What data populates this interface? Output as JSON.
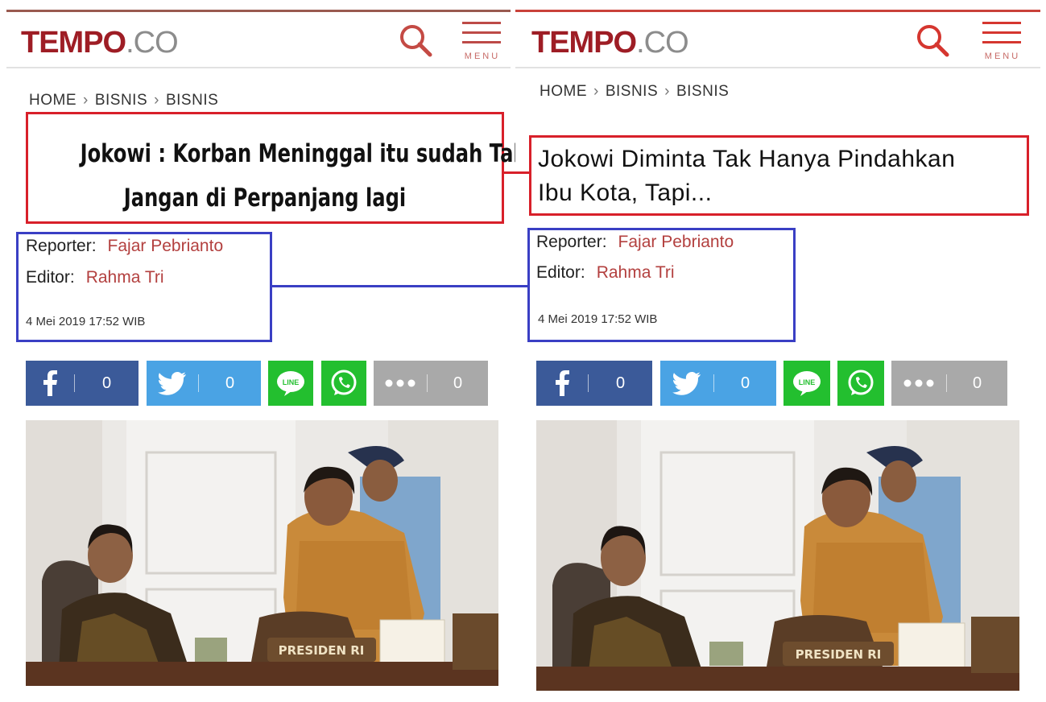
{
  "left": {
    "logo_bold": "TEMPO",
    "logo_light": ".CO",
    "menu_label": "MENU",
    "breadcrumb": [
      "HOME",
      "BISNIS",
      "BISNIS"
    ],
    "title_line1": "Jokowi : Korban Meninggal itu sudah Takdir",
    "title_line2": "Jangan di Perpanjang lagi",
    "reporter_label": "Reporter:",
    "reporter": "Fajar Pebrianto",
    "editor_label": "Editor:",
    "editor": "Rahma Tri",
    "date": "4 Mei 2019 17:52 WIB",
    "share": {
      "facebook": "0",
      "twitter": "0",
      "more": "0",
      "line_label": "LINE"
    },
    "photo_nameplate": "PRESIDEN RI"
  },
  "right": {
    "logo_bold": "TEMPO",
    "logo_light": ".CO",
    "menu_label": "MENU",
    "breadcrumb": [
      "HOME",
      "BISNIS",
      "BISNIS"
    ],
    "title_line1": "Jokowi Diminta Tak Hanya Pindahkan",
    "title_line2": "Ibu Kota, Tapi...",
    "reporter_label": "Reporter:",
    "reporter": "Fajar Pebrianto",
    "editor_label": "Editor:",
    "editor": "Rahma Tri",
    "date": "4 Mei 2019 17:52 WIB",
    "share": {
      "facebook": "0",
      "twitter": "0",
      "more": "0",
      "line_label": "LINE"
    },
    "photo_nameplate": "PRESIDEN RI"
  },
  "colors": {
    "brand": "#9e1d25",
    "annotation_red": "#d8202a",
    "annotation_blue": "#3a3fc4",
    "facebook": "#3b5a99",
    "twitter": "#4aa3e4",
    "line_whatsapp": "#23bf2f",
    "more": "#a9a9a9"
  }
}
